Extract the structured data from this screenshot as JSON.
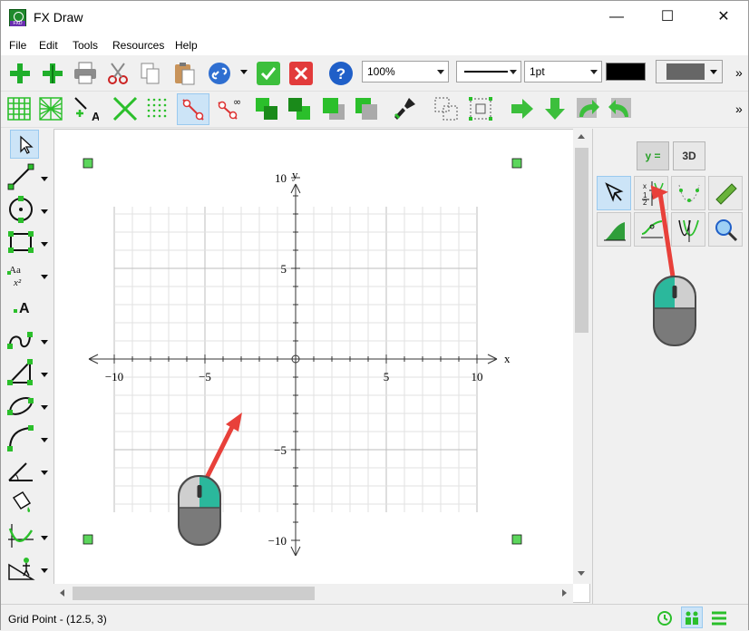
{
  "window": {
    "title": "FX Draw"
  },
  "window_controls": {
    "minimize": "—",
    "maximize": "☐",
    "close": "✕"
  },
  "menu": [
    "File",
    "Edit",
    "Tools",
    "Resources",
    "Help"
  ],
  "toolbar": {
    "zoom_value": "100%",
    "line_width_value": "1pt",
    "more_glyph": "»"
  },
  "graph": {
    "x_axis_label": "x",
    "y_axis_label": "y",
    "x_ticks": [
      "−10",
      "−5",
      "5",
      "10"
    ],
    "y_ticks": [
      "10",
      "5",
      "−5",
      "−10"
    ]
  },
  "right_panel": {
    "tab_equation": "y =",
    "tab_3d": "3D"
  },
  "status": {
    "text": "Grid Point - (12.5, 3)"
  },
  "colors": {
    "accent_green": "#2bbf2b",
    "pointer_red": "#e8403a",
    "mouse_teal": "#2bb89c",
    "selected_tool_blue": "#cce4f7"
  }
}
